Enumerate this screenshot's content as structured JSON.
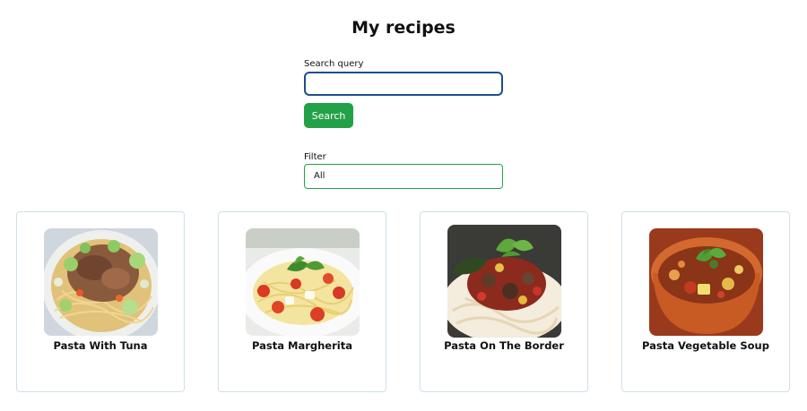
{
  "header": {
    "title": "My recipes"
  },
  "search": {
    "label": "Search query",
    "value": "",
    "button_label": "Search"
  },
  "filter": {
    "label": "Filter",
    "selected": "All"
  },
  "recipes": [
    {
      "title": "Pasta With Tuna",
      "image_icon": "pasta-tuna-photo"
    },
    {
      "title": "Pasta Margherita",
      "image_icon": "pasta-margherita-photo"
    },
    {
      "title": "Pasta On The Border",
      "image_icon": "pasta-border-photo"
    },
    {
      "title": "Pasta Vegetable Soup",
      "image_icon": "vegetable-soup-photo"
    }
  ],
  "colors": {
    "accent_green": "#23a148",
    "input_border_blue": "#1a4f8f",
    "card_border": "#cfe0ea"
  }
}
